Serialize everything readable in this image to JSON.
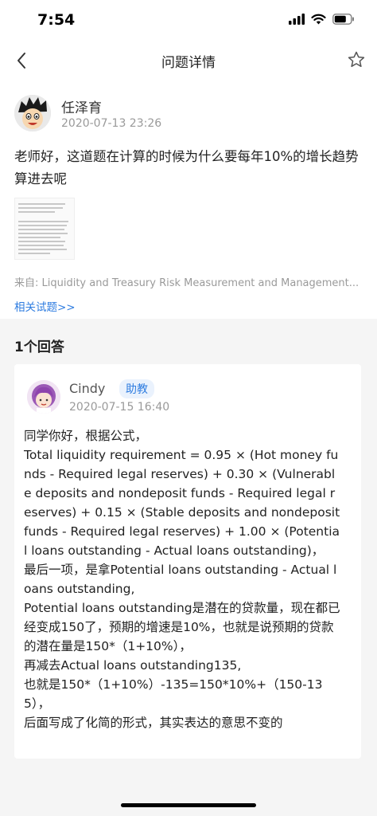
{
  "status_bar": {
    "time": "7:54"
  },
  "nav": {
    "title": "问题详情"
  },
  "question": {
    "author": "任泽育",
    "time": "2020-07-13 23:26",
    "text": "老师好，这道题在计算的时候为什么要每年10%的增长趋势算进去呢",
    "source": "来自: Liquidity and Treasury Risk Measurement and Management...",
    "related_link": "相关试题>>"
  },
  "answers": {
    "count_label": "1个回答",
    "items": [
      {
        "author": "Cindy",
        "badge": "助教",
        "time": "2020-07-15 16:40",
        "lines": [
          "同学你好，根据公式，",
          "Total liquidity requirement = 0.95 × (Hot money funds - Required legal reserves) + 0.30 × (Vulnerable deposits and nondeposit funds - Required legal reserves) + 0.15 × (Stable deposits and nondeposit funds - Required legal reserves) + 1.00 × (Potential loans outstanding - Actual loans outstanding)，",
          "最后一项，是拿Potential loans outstanding - Actual loans outstanding,",
          "Potential loans outstanding是潜在的贷款量，现在都已经变成150了，预期的增速是10%，也就是说预期的贷款的潜在量是150*（1+10%），",
          "再减去Actual loans outstanding135,",
          "也就是150*（1+10%）-135=150*10%+（150-135），",
          "后面写成了化简的形式，其实表达的意思不变的"
        ]
      }
    ]
  }
}
